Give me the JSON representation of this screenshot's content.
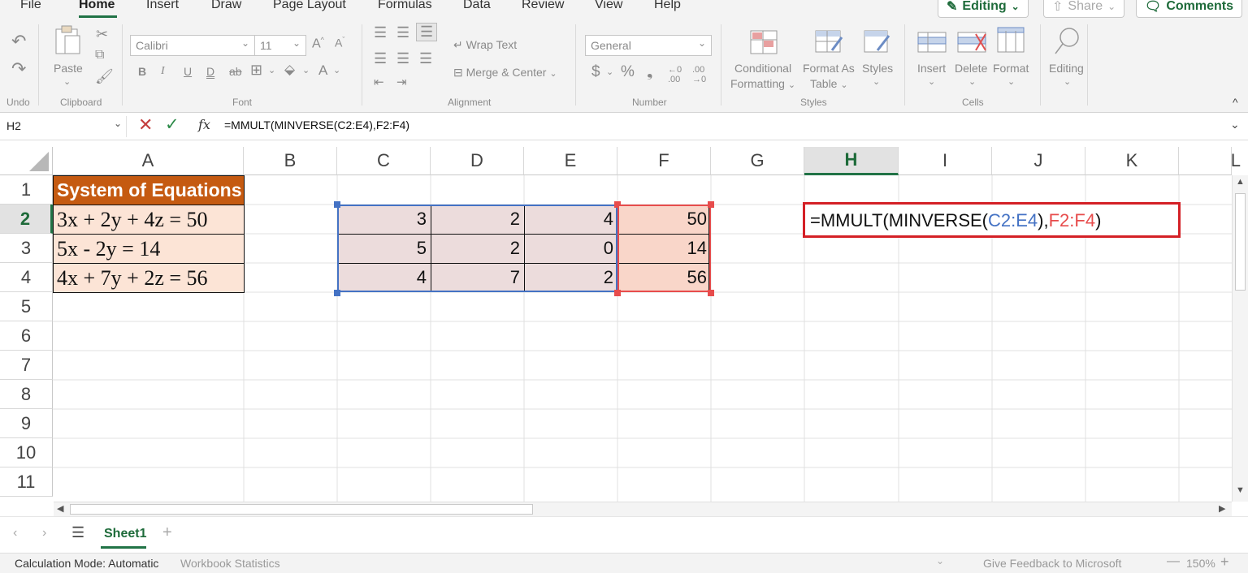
{
  "tabs": [
    "File",
    "Home",
    "Insert",
    "Draw",
    "Page Layout",
    "Formulas",
    "Data",
    "Review",
    "View",
    "Help"
  ],
  "active_tab": "Home",
  "top_buttons": {
    "editing": "Editing",
    "share": "Share",
    "comments": "Comments"
  },
  "ribbon": {
    "groups": {
      "undo": "Undo",
      "clipboard": "Clipboard",
      "font": "Font",
      "alignment": "Alignment",
      "number": "Number",
      "styles": "Styles",
      "cells": "Cells"
    },
    "paste": "Paste",
    "font_name": "Calibri",
    "font_size": "11",
    "wrap_text": "Wrap Text",
    "merge_center": "Merge & Center",
    "number_format": "General",
    "conditional": [
      "Conditional",
      "Formatting"
    ],
    "format_as": [
      "Format As",
      "Table"
    ],
    "styles_btn": "Styles",
    "insert": "Insert",
    "delete": "Delete",
    "format": "Format",
    "editing": "Editing"
  },
  "formula_bar": {
    "name_box": "H2",
    "formula": "=MMULT(MINVERSE(C2:E4),F2:F4)"
  },
  "columns": [
    "A",
    "B",
    "C",
    "D",
    "E",
    "F",
    "G",
    "H",
    "I",
    "J",
    "K",
    "L"
  ],
  "rows": [
    "1",
    "2",
    "3",
    "4",
    "5",
    "6",
    "7",
    "8",
    "9",
    "10",
    "11"
  ],
  "selected_cell": {
    "column": "H",
    "row": "2"
  },
  "cells": {
    "A1": "System of Equations",
    "A2": "3x + 2y + 4z = 50",
    "A3": "5x - 2y = 14",
    "A4": "4x + 7y + 2z = 56",
    "matrix": [
      [
        "3",
        "2",
        "4"
      ],
      [
        "5",
        "2",
        "0"
      ],
      [
        "4",
        "7",
        "2"
      ]
    ],
    "constants": [
      "50",
      "14",
      "56"
    ],
    "H2_edit": {
      "part1": "=MMULT(MINVERSE(",
      "ref1": "C2:E4",
      "part2": "),",
      "ref2": "F2:F4",
      "part3": ")"
    }
  },
  "colors": {
    "accent": "#217346",
    "header_fill": "#c55a11",
    "light_fill": "#fce4d6",
    "ref_blue": "#4472c4",
    "ref_red": "#e74c4c",
    "edit_border": "#d42026"
  },
  "sheet_tab": "Sheet1",
  "status": {
    "calc_mode": "Calculation Mode: Automatic",
    "stats": "Workbook Statistics",
    "feedback": "Give Feedback to Microsoft",
    "zoom": "150%"
  }
}
